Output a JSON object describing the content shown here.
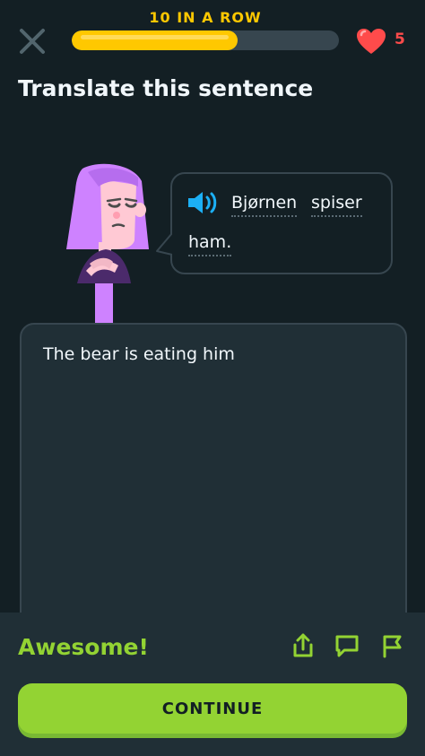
{
  "header": {
    "streak_label": "10 IN A ROW",
    "progress": 0.62,
    "hearts_count": "5",
    "close_icon": "close-icon",
    "heart_icon": "heart-icon"
  },
  "exercise": {
    "title": "Translate this sentence",
    "prompt_words": [
      "Bjørnen",
      "spiser",
      "ham."
    ],
    "speaker_icon": "speaker-icon",
    "answer": "The bear is eating him"
  },
  "feedback": {
    "title": "Awesome!",
    "icons": [
      "share-icon",
      "comment-icon",
      "report-flag-icon"
    ],
    "continue_label": "CONTINUE"
  },
  "colors": {
    "background": "#131f24",
    "panel": "#202f36",
    "border": "#37464f",
    "text": "#f1f7fb",
    "streak": "#ffc800",
    "heart": "#ff4b4b",
    "success": "#93d333",
    "speaker": "#1cb0f6",
    "character_hair": "#ce82ff"
  }
}
